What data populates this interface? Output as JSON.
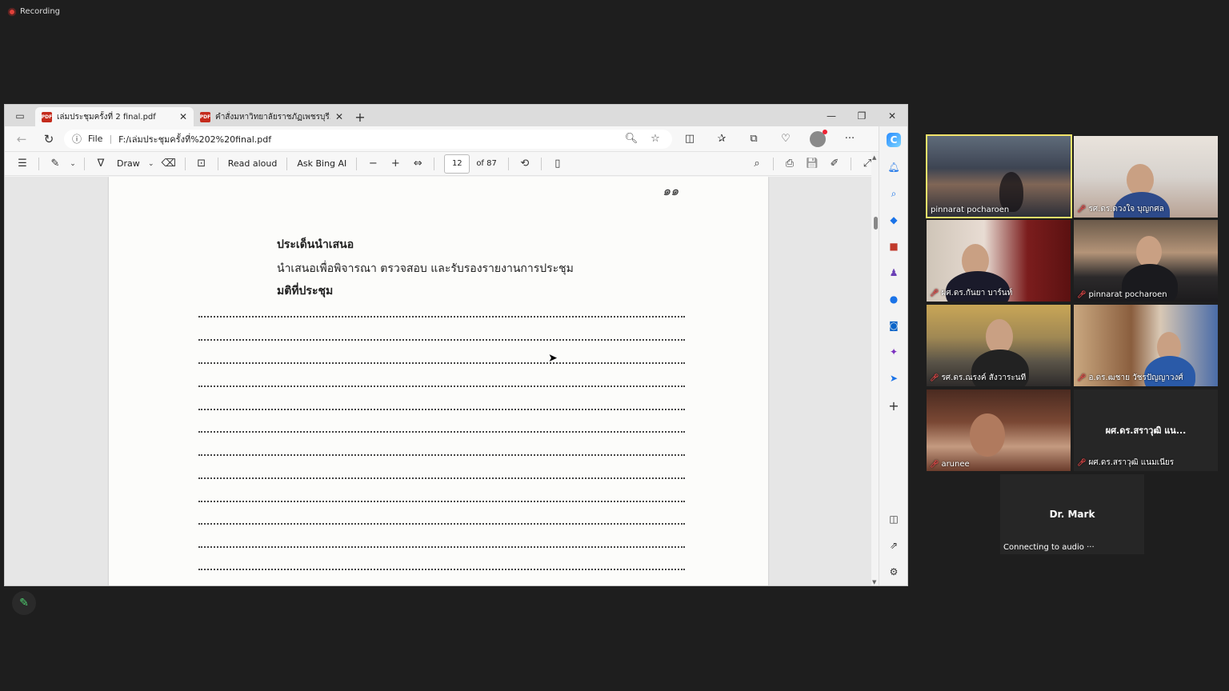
{
  "recording": {
    "label": "Recording"
  },
  "browser": {
    "tabs": [
      {
        "label": "เล่มประชุมครั้งที่ 2 final.pdf",
        "close": "✕"
      },
      {
        "label": "คำสั่งมหาวิทยาลัยราชภัฏเพชรบุรี.pdf",
        "close": "✕"
      }
    ],
    "new_tab": "+",
    "window": {
      "minimize": "—",
      "maximize": "❐",
      "close": "✕"
    },
    "address": {
      "scheme": "File",
      "url": "F:/เล่มประชุมครั้งที่%202%20final.pdf"
    }
  },
  "pdf_toolbar": {
    "draw_label": "Draw",
    "read_aloud_label": "Read aloud",
    "ask_label": "Ask Bing AI",
    "page_current": "12",
    "page_total": "of 87"
  },
  "document": {
    "page_number": "๑๑",
    "heading": "ประเด็นนำเสนอ",
    "line1": "นำเสนอเพื่อพิจารณา ตรวจสอบ และรับรองรายงานการประชุม",
    "line2": "มติที่ประชุม"
  },
  "participants": [
    {
      "name": "pinnarat pocharoen",
      "muted": false,
      "speaking": true
    },
    {
      "name": "รศ.ดร.ดวงใจ บุญกศล",
      "muted": true
    },
    {
      "name": "ผศ.ดร.กันยา บาร์นท์",
      "muted": true
    },
    {
      "name": "pinnarat pocharoen",
      "muted": true
    },
    {
      "name": "รศ.ดร.ณรงค์ สังวาระนที",
      "muted": true
    },
    {
      "name": "อ.ดร.ฒชาย วัชรปัญญาวงศ์",
      "muted": true
    },
    {
      "name": "arunee",
      "muted": true
    },
    {
      "name": "ผศ.ดร.สราวุฒิ แนมเนียร",
      "muted": true,
      "display": "ผศ.ดร.สราวุฒิ แน..."
    }
  ],
  "dr_mark": {
    "name": "Dr. Mark",
    "status": "Connecting to audio ···"
  },
  "colors": {
    "speaking_border": "#f2e36a",
    "muted_mic": "#e04848",
    "pdf_red": "#c42b1c"
  }
}
